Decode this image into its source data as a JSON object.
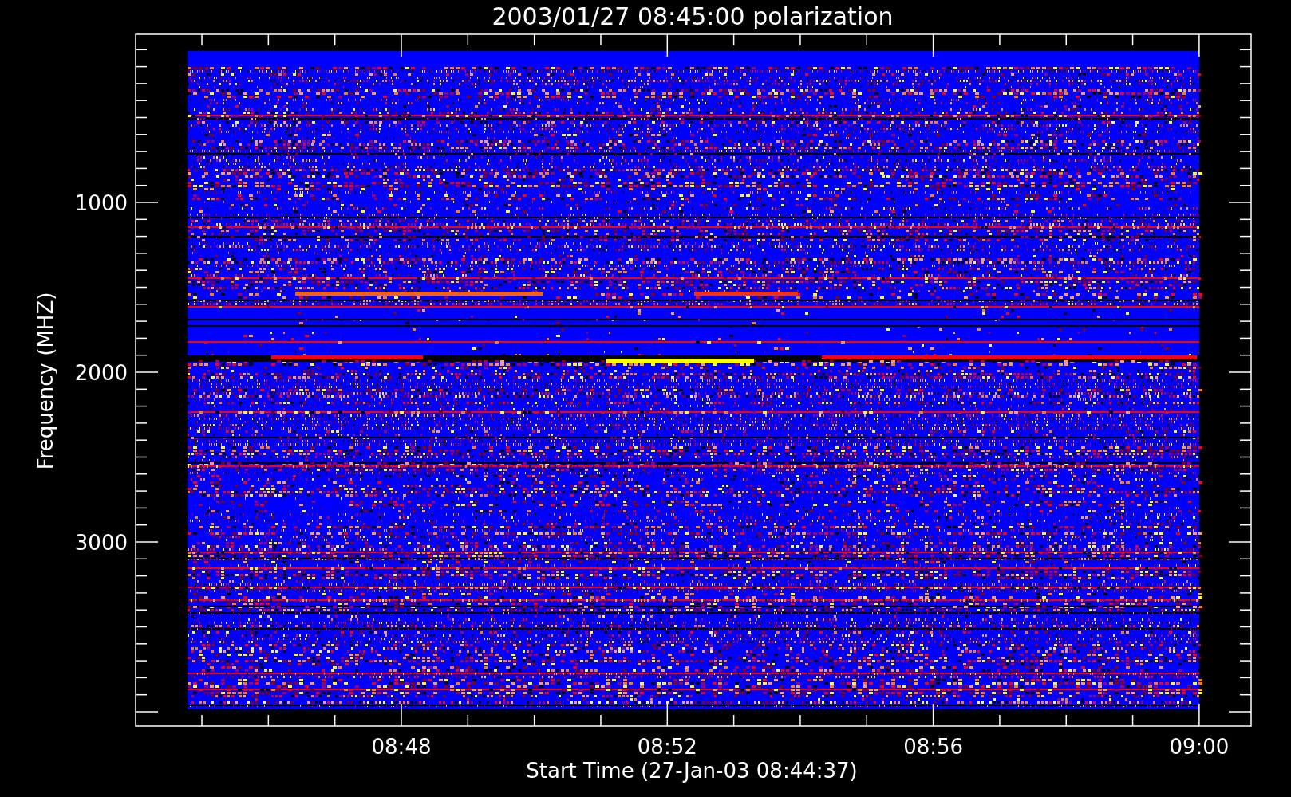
{
  "title": "2003/01/27 08:45:00 polarization",
  "x_axis": {
    "label": "Start Time (27-Jan-03 08:44:37)",
    "ticks": [
      "08:48",
      "08:52",
      "08:56",
      "09:00"
    ]
  },
  "y_axis": {
    "label": "Frequency (MHZ)",
    "ticks": [
      "1000",
      "2000",
      "3000"
    ]
  }
}
